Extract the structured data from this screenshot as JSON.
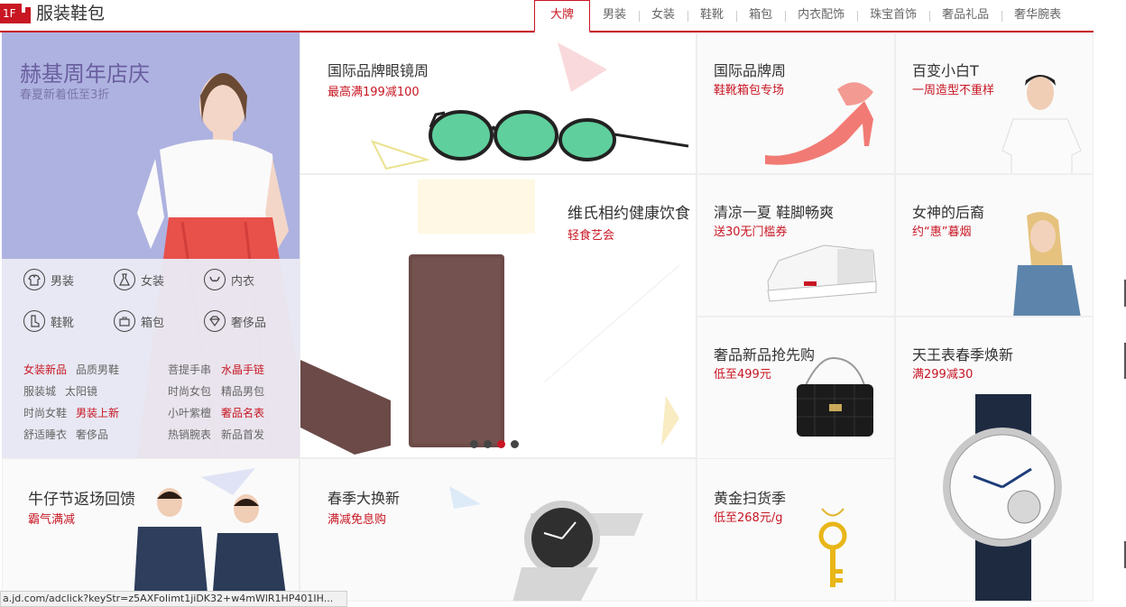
{
  "header": {
    "badge": "1F",
    "title": "服装鞋包",
    "tabs": [
      "大牌",
      "男装",
      "女装",
      "鞋靴",
      "箱包",
      "内衣配饰",
      "珠宝首饰",
      "奢品礼品",
      "奢华腕表"
    ]
  },
  "left_banner": {
    "title": "赫基周年店庆",
    "subtitle": "春夏新着低至3折",
    "categories": [
      {
        "label": "男装",
        "icon": "shirt-icon"
      },
      {
        "label": "女装",
        "icon": "dress-icon"
      },
      {
        "label": "内衣",
        "icon": "bra-icon"
      },
      {
        "label": "鞋靴",
        "icon": "boot-icon"
      },
      {
        "label": "箱包",
        "icon": "bag-icon"
      },
      {
        "label": "奢侈品",
        "icon": "diamond-icon"
      }
    ],
    "links": [
      {
        "text": "女装新品",
        "red": true
      },
      {
        "text": "品质男鞋",
        "red": false
      },
      {
        "text": "菩提手串",
        "red": false
      },
      {
        "text": "水晶手链",
        "red": true
      },
      {
        "text": "服装城",
        "red": false
      },
      {
        "text": "太阳镜",
        "red": false
      },
      {
        "text": "时尚女包",
        "red": false
      },
      {
        "text": "精品男包",
        "red": false
      },
      {
        "text": "时尚女鞋",
        "red": false
      },
      {
        "text": "男装上新",
        "red": true
      },
      {
        "text": "小叶紫檀",
        "red": false
      },
      {
        "text": "奢品名表",
        "red": true
      },
      {
        "text": "舒适睡衣",
        "red": false
      },
      {
        "text": "奢侈品",
        "red": false
      },
      {
        "text": "热销腕表",
        "red": false
      },
      {
        "text": "新品首发",
        "red": false
      }
    ]
  },
  "cells": {
    "glasses": {
      "title": "国际品牌眼镜周",
      "sub": "最高满199减100"
    },
    "carousel": {
      "title": "维氏相约健康饮食",
      "sub": "轻食艺会",
      "active_dot": 3
    },
    "brand_week": {
      "title": "国际品牌周",
      "sub": "鞋靴箱包专场"
    },
    "white_tee": {
      "title": "百变小白T",
      "sub": "一周造型不重样"
    },
    "sneakers": {
      "title": "清凉一夏 鞋脚畅爽",
      "sub": "送30无门槛券"
    },
    "goddess": {
      "title": "女神的后裔",
      "sub": "约“惠”暮烟"
    },
    "luxury": {
      "title": "奢品新品抢先购",
      "sub": "低至499元"
    },
    "watch_king": {
      "title": "天王表春季焕新",
      "sub": "满299减30"
    },
    "jeans": {
      "title": "牛仔节返场回馈",
      "sub": "霸气满减"
    },
    "spring": {
      "title": "春季大换新",
      "sub": "满减免息购"
    },
    "gold": {
      "title": "黄金扫货季",
      "sub": "低至268元/g"
    }
  },
  "status_url": "a.jd.com/adclick?keyStr=z5AXFoIimt1jiDK32+w4mWlR1HP401IH...",
  "colors": {
    "accent": "#c81623",
    "banner_bg": "#aeb2e0"
  }
}
